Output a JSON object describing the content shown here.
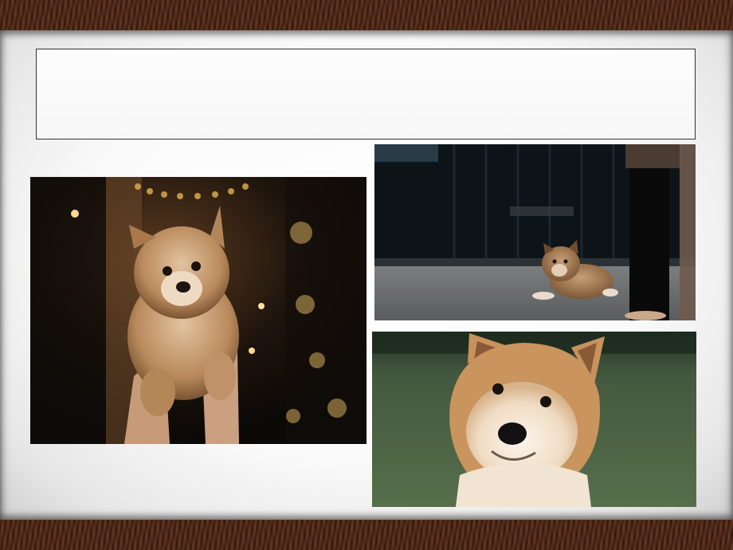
{
  "slide": {
    "title": "",
    "photos": [
      {
        "subject": "puppy-held-up"
      },
      {
        "subject": "puppy-lying-on-floor"
      },
      {
        "subject": "adult-akita-on-grass"
      }
    ]
  },
  "colors": {
    "frame_wood": "#4a2616",
    "slide_background": "#f8f8f8",
    "title_border": "#333333",
    "dog_fur": "#c8925c",
    "grass": "#4f6a45"
  }
}
